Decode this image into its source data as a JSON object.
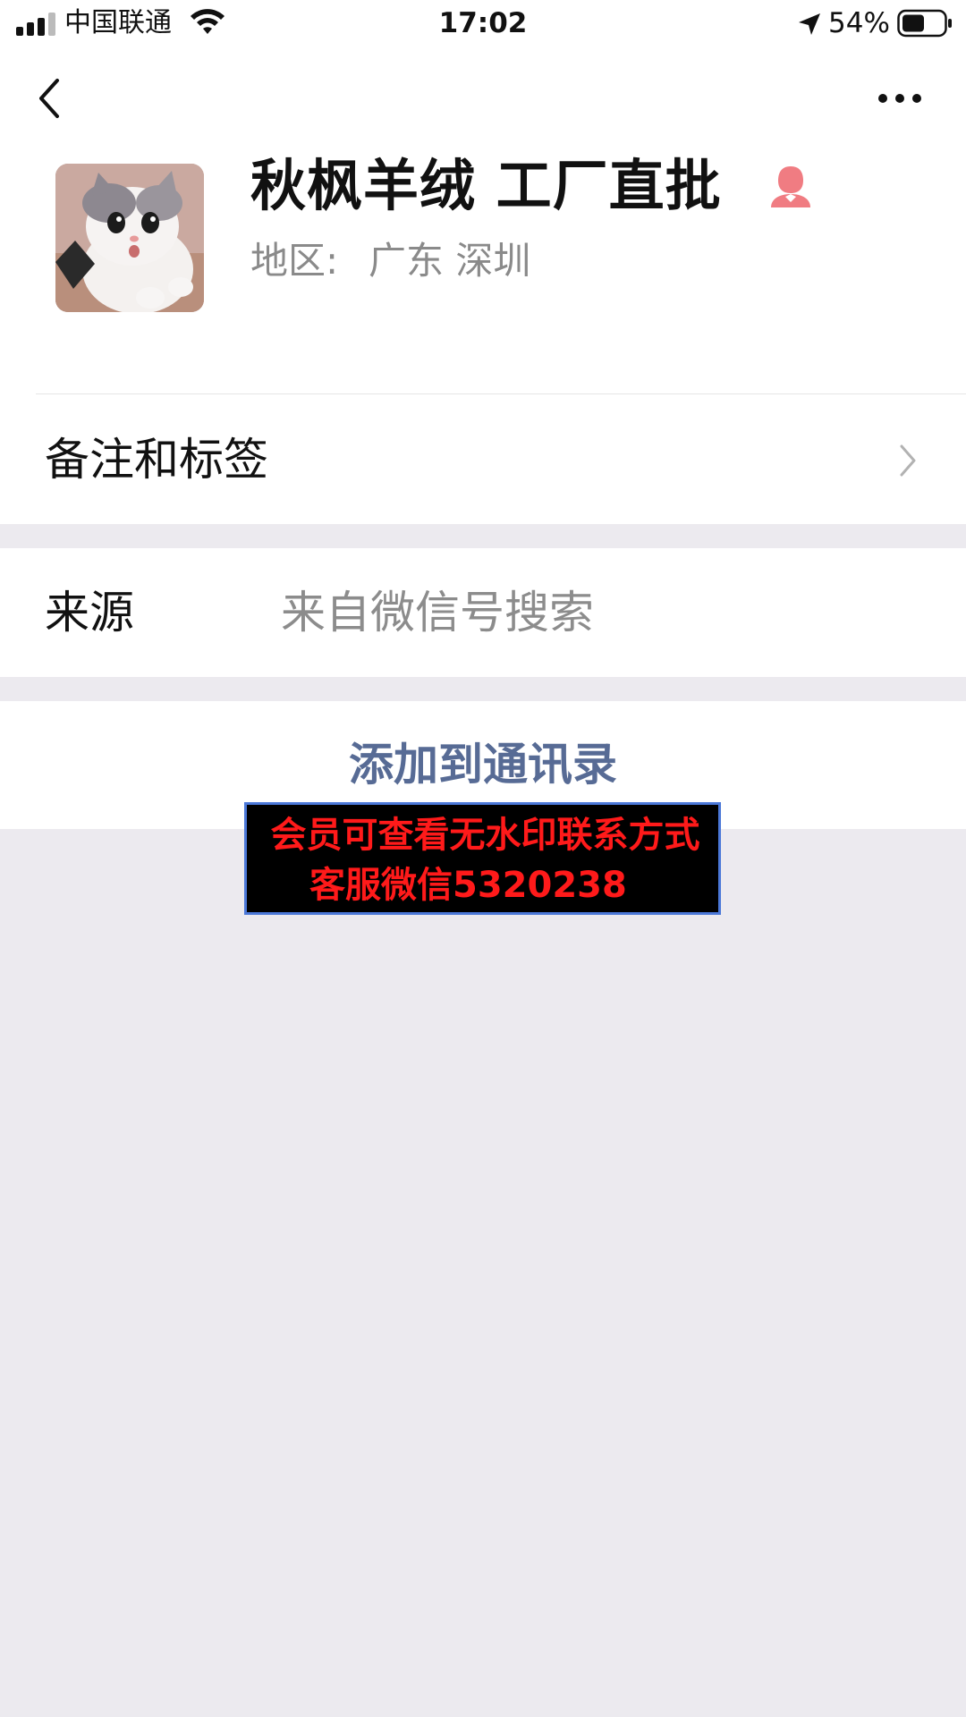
{
  "status_bar": {
    "carrier": "中国联通",
    "time": "17:02",
    "battery_percent": "54%",
    "battery_level": 0.54,
    "icons": [
      "signal-icon",
      "wifi-icon",
      "location-arrow-icon",
      "battery-icon"
    ]
  },
  "nav": {
    "back_icon": "chevron-left-icon",
    "more_icon": "more-dots-icon"
  },
  "profile": {
    "name": "秋枫羊绒 工厂直批",
    "gender_icon": "female-icon",
    "region_label": "地区:",
    "region_value": "广东 深圳",
    "avatar": "cat-photo"
  },
  "rows": {
    "notes_tags": "备注和标签",
    "source_label": "来源",
    "source_value": "来自微信号搜索",
    "add_contact": "添加到通讯录"
  },
  "watermark": {
    "line1": "会员可查看无水印联系方式",
    "line2": "客服微信5320238"
  },
  "colors": {
    "link_blue": "#576B95",
    "background_gray": "#ECEAEF",
    "female_pink": "#F07C82",
    "watermark_red": "#FF1A1A"
  }
}
